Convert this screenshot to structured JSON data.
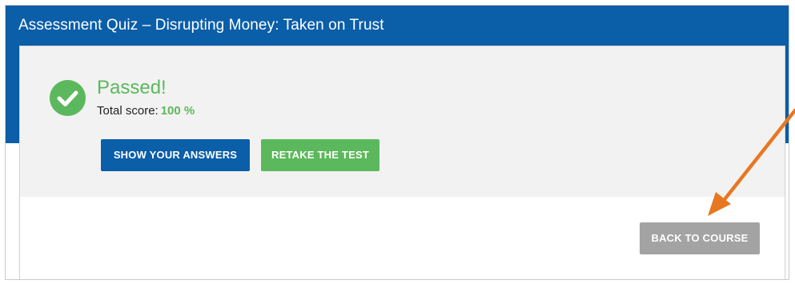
{
  "header": {
    "title": "Assessment Quiz – Disrupting Money: Taken on Trust"
  },
  "result": {
    "status": "Passed!",
    "score_label": "Total score:",
    "score_value": "100 %",
    "status_icon": "check-circle-icon"
  },
  "actions": {
    "show_answers_label": "SHOW YOUR ANSWERS",
    "retake_label": "RETAKE THE TEST",
    "back_label": "BACK TO COURSE"
  },
  "annotation": {
    "arrow_icon": "arrow-annotation-icon"
  },
  "colors": {
    "brand_blue": "#0b5ea8",
    "success_green": "#5cb85c",
    "disabled_gray": "#a3a3a3",
    "annotation_orange": "#e87722"
  }
}
